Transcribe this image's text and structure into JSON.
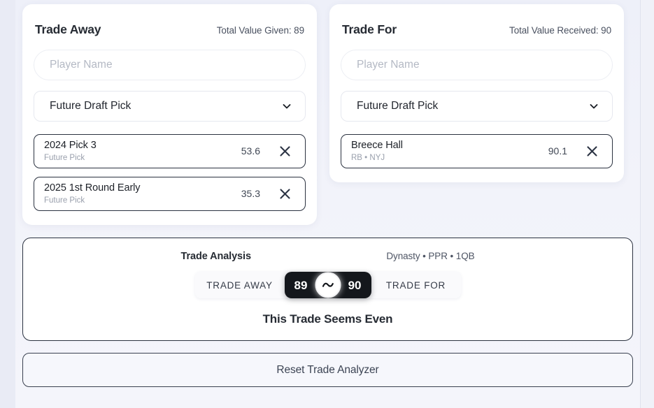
{
  "theme": {
    "page_bg": "#f2f3fa",
    "card_bg": "#ffffff",
    "border_dark": "#2b3240",
    "meter_core_bg": "#14171c",
    "muted_text": "#9aa0ad"
  },
  "trade_away": {
    "title": "Trade Away",
    "total_label": "Total Value Given: 89",
    "player_input": {
      "placeholder": "Player Name",
      "value": ""
    },
    "pick_select": {
      "selected": "Future Draft Pick"
    },
    "assets": [
      {
        "name": "2024 Pick 3",
        "subtitle": "Future Pick",
        "value": "53.6",
        "remove": "×"
      },
      {
        "name": "2025 1st Round Early",
        "subtitle": "Future Pick",
        "value": "35.3",
        "remove": "×"
      }
    ]
  },
  "trade_for": {
    "title": "Trade For",
    "total_label": "Total Value Received: 90",
    "player_input": {
      "placeholder": "Player Name",
      "value": ""
    },
    "pick_select": {
      "selected": "Future Draft Pick"
    },
    "assets": [
      {
        "name": "Breece Hall",
        "subtitle": "RB • NYJ",
        "value": "90.1",
        "remove": "×"
      }
    ]
  },
  "analysis": {
    "title": "Trade Analysis",
    "format": "Dynasty • PPR • 1QB",
    "meter": {
      "left_label": "TRADE AWAY",
      "right_label": "TRADE FOR",
      "left_score": "89",
      "right_score": "90",
      "balance_icon": "tilde-icon"
    },
    "verdict": "This Trade Seems Even"
  },
  "reset": {
    "label": "Reset Trade Analyzer"
  }
}
